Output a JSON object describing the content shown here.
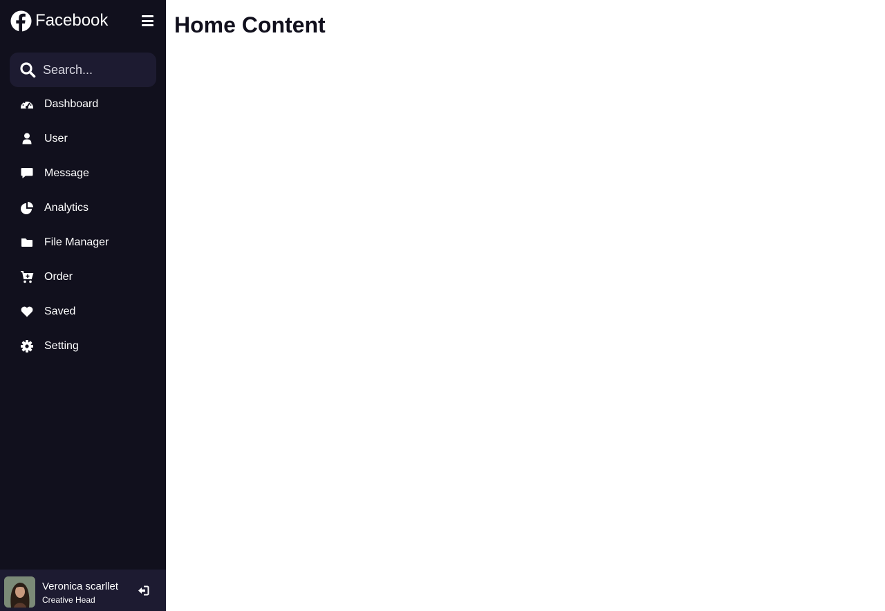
{
  "app": {
    "name": "Facebook"
  },
  "search": {
    "placeholder": "Search..."
  },
  "sidebar": {
    "items": [
      {
        "label": "Dashboard",
        "icon": "dashboard-icon"
      },
      {
        "label": "User",
        "icon": "user-icon"
      },
      {
        "label": "Message",
        "icon": "message-icon"
      },
      {
        "label": "Analytics",
        "icon": "analytics-icon"
      },
      {
        "label": "File Manager",
        "icon": "folder-icon"
      },
      {
        "label": "Order",
        "icon": "cart-icon"
      },
      {
        "label": "Saved",
        "icon": "heart-icon"
      },
      {
        "label": "Setting",
        "icon": "gear-icon"
      }
    ]
  },
  "profile": {
    "name": "Veronica scarllet",
    "job": "Creative Head"
  },
  "main": {
    "title": "Home Content"
  },
  "colors": {
    "sidebar_bg": "#11101d",
    "search_bg": "#1d1b31",
    "text": "#ffffff"
  }
}
